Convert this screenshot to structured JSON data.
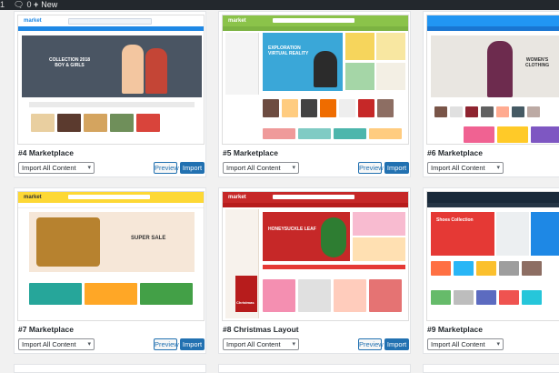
{
  "adminbar": {
    "count_label": "0",
    "new_label": "New"
  },
  "colors": {
    "accent": "#2271b1",
    "adminbar": "#23282d"
  },
  "layouts": [
    {
      "title": "#4 Marketplace",
      "select": "Import All Content",
      "preview": "Preview",
      "import": "Import"
    },
    {
      "title": "#5 Marketplace",
      "select": "Import All Content",
      "preview": "Preview",
      "import": "Import"
    },
    {
      "title": "#6 Marketplace",
      "select": "Import All Content"
    },
    {
      "title": "#7 Marketplace",
      "select": "Import All Content",
      "preview": "Preview",
      "import": "Import"
    },
    {
      "title": "#8 Christmas Layout",
      "select": "Import All Content",
      "preview": "Preview",
      "import": "Import"
    },
    {
      "title": "#9 Marketplace",
      "select": "Import All Content"
    }
  ],
  "thumbnails": {
    "t4": {
      "logo": "market",
      "banner_line1": "COLLECTION 2018",
      "banner_line2": "BOY & GIRLS"
    },
    "t5": {
      "logo": "market",
      "banner_line1": "EXPLORATION",
      "banner_line2": "VIRTUAL REALITY"
    },
    "t6": {
      "banner_line1": "WOMEN'S",
      "banner_line2": "CLOTHING"
    },
    "t7": {
      "logo": "market",
      "banner_line1": "SUPER SALE"
    },
    "t8": {
      "logo": "market",
      "banner_line1": "HONEYSUCKLE LEAF",
      "side": "Christmas"
    },
    "t9": {
      "banner_line1": "Shoes Collection"
    }
  }
}
